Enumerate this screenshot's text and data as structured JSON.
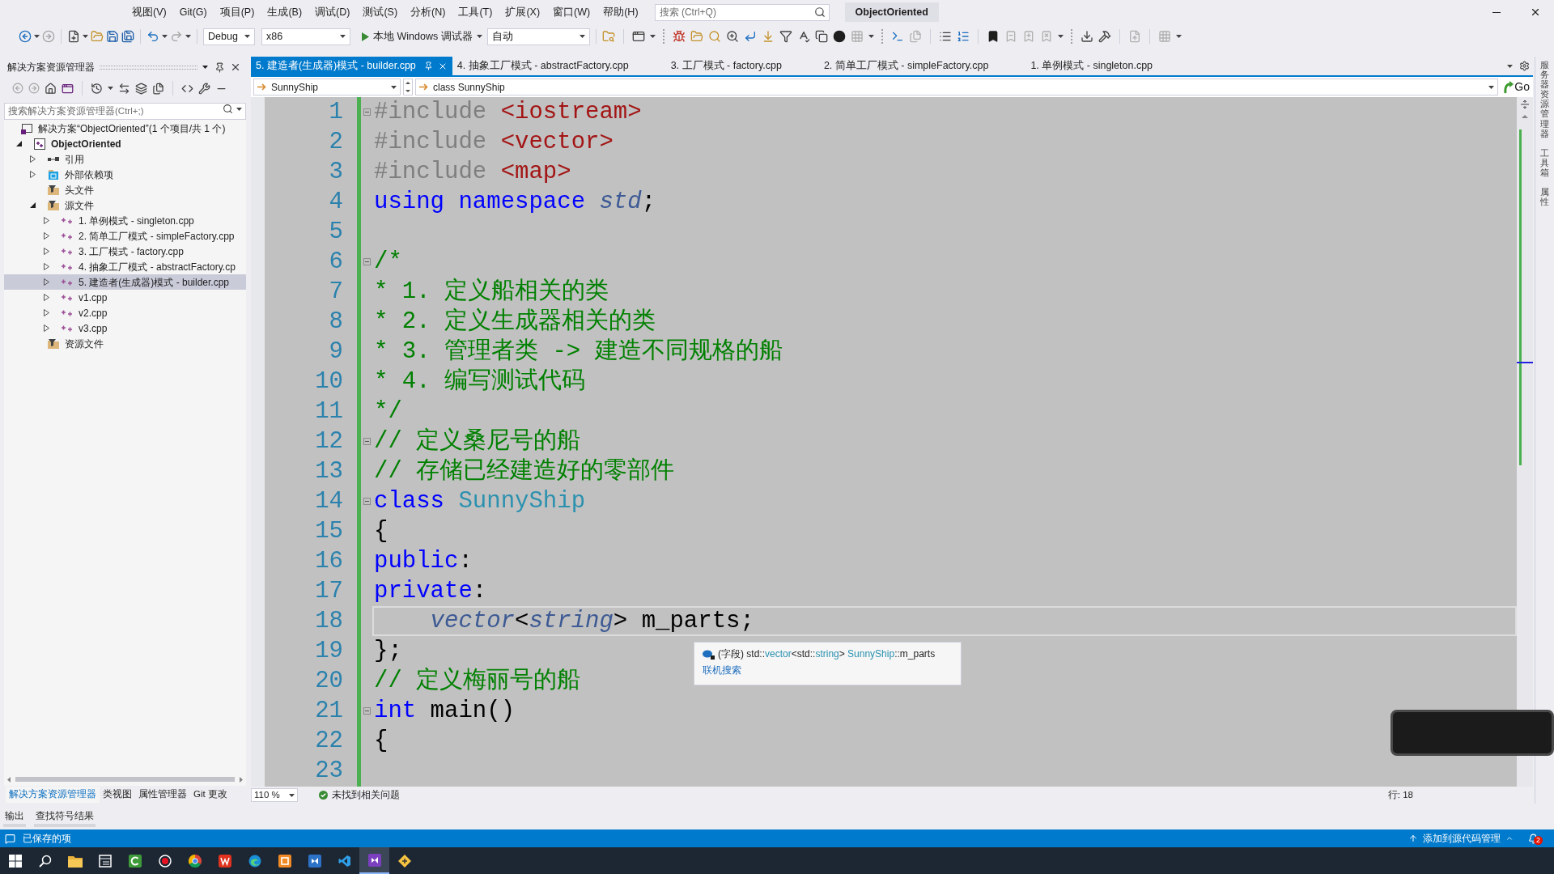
{
  "menu": [
    "视图(V)",
    "Git(G)",
    "项目(P)",
    "生成(B)",
    "调试(D)",
    "测试(S)",
    "分析(N)",
    "工具(T)",
    "扩展(X)",
    "窗口(W)",
    "帮助(H)"
  ],
  "search": {
    "placeholder": "搜索 (Ctrl+Q)"
  },
  "solution_badge": "ObjectOriented",
  "toolbar": {
    "configuration": "Debug",
    "platform": "x86",
    "run": "本地 Windows 调试器",
    "mode": "自动"
  },
  "solution_explorer": {
    "title": "解决方案资源管理器",
    "search": {
      "placeholder": "搜索解决方案资源管理器(Ctrl+;)"
    },
    "tree": [
      {
        "kind": "solution",
        "label": "解决方案“ObjectOriented”(1 个项目/共 1 个)",
        "selected": false,
        "children": [
          {
            "kind": "project",
            "label": "ObjectOriented",
            "expanded": true,
            "selected": false,
            "children": [
              {
                "kind": "references",
                "label": "引用",
                "expanded": false,
                "selected": false
              },
              {
                "kind": "dependencies",
                "label": "外部依赖项",
                "expanded": false,
                "selected": false
              },
              {
                "kind": "filter",
                "label": "头文件",
                "selected": false
              },
              {
                "kind": "filter",
                "label": "源文件",
                "expanded": true,
                "selected": false,
                "children": [
                  {
                    "kind": "file",
                    "label": "1. 单例模式 - singleton.cpp",
                    "expanded": false,
                    "selected": false
                  },
                  {
                    "kind": "file",
                    "label": "2. 简单工厂模式 - simpleFactory.cpp",
                    "expanded": false,
                    "selected": false
                  },
                  {
                    "kind": "file",
                    "label": "3. 工厂模式 - factory.cpp",
                    "expanded": false,
                    "selected": false
                  },
                  {
                    "kind": "file",
                    "label": "4. 抽象工厂模式 - abstractFactory.cp",
                    "expanded": false,
                    "selected": false
                  },
                  {
                    "kind": "file",
                    "label": "5. 建造者(生成器)模式 - builder.cpp",
                    "expanded": false,
                    "selected": true
                  },
                  {
                    "kind": "file",
                    "label": "v1.cpp",
                    "expanded": false,
                    "selected": false
                  },
                  {
                    "kind": "file",
                    "label": "v2.cpp",
                    "expanded": false,
                    "selected": false
                  },
                  {
                    "kind": "file",
                    "label": "v3.cpp",
                    "expanded": false,
                    "selected": false
                  }
                ]
              },
              {
                "kind": "filter",
                "label": "资源文件",
                "selected": false
              }
            ]
          }
        ]
      }
    ],
    "tabs": [
      {
        "label": "解决方案资源管理器",
        "selected": true
      },
      {
        "label": "类视图",
        "selected": false
      },
      {
        "label": "属性管理器",
        "selected": false
      },
      {
        "label": "Git 更改",
        "selected": false
      }
    ]
  },
  "editor": {
    "tabs": [
      {
        "label": "5. 建造者(生成器)模式 - builder.cpp",
        "selected": true
      },
      {
        "label": "4. 抽象工厂模式 - abstractFactory.cpp",
        "selected": false
      },
      {
        "label": "3. 工厂模式 - factory.cpp",
        "selected": false
      },
      {
        "label": "2. 简单工厂模式 - simpleFactory.cpp",
        "selected": false
      },
      {
        "label": "1. 单例模式 - singleton.cpp",
        "selected": false
      }
    ],
    "scope": "SunnyShip",
    "member": "class SunnyShip",
    "go": "Go",
    "lines": [
      {
        "number": "1",
        "foldable": true,
        "current": false,
        "indented": false,
        "tokens": [
          {
            "kind": "directive",
            "text": "#include "
          },
          {
            "kind": "header",
            "text": "<iostream>"
          }
        ]
      },
      {
        "number": "2",
        "foldable": false,
        "current": false,
        "indented": false,
        "tokens": [
          {
            "kind": "directive",
            "text": "#include "
          },
          {
            "kind": "header",
            "text": "<vector>"
          }
        ]
      },
      {
        "number": "3",
        "foldable": false,
        "current": false,
        "indented": false,
        "tokens": [
          {
            "kind": "directive",
            "text": "#include "
          },
          {
            "kind": "header",
            "text": "<map>"
          }
        ]
      },
      {
        "number": "4",
        "foldable": false,
        "current": false,
        "indented": false,
        "tokens": [
          {
            "kind": "keyword",
            "text": "using namespace "
          },
          {
            "kind": "namespace",
            "text": "std"
          },
          {
            "kind": "plain",
            "text": ";"
          }
        ]
      },
      {
        "number": "5",
        "foldable": false,
        "current": false
      },
      {
        "number": "6",
        "foldable": true,
        "current": false,
        "indented": false,
        "tokens": [
          {
            "kind": "comment",
            "text": "/*"
          }
        ]
      },
      {
        "number": "7",
        "foldable": false,
        "current": false,
        "indented": false,
        "tokens": [
          {
            "kind": "comment",
            "text": "* 1. 定义船相关的类"
          }
        ]
      },
      {
        "number": "8",
        "foldable": false,
        "current": false,
        "indented": false,
        "tokens": [
          {
            "kind": "comment",
            "text": "* 2. 定义生成器相关的类"
          }
        ]
      },
      {
        "number": "9",
        "foldable": false,
        "current": false,
        "indented": false,
        "tokens": [
          {
            "kind": "comment",
            "text": "* 3. 管理者类 -> 建造不同规格的船"
          }
        ]
      },
      {
        "number": "10",
        "foldable": false,
        "current": false,
        "indented": false,
        "tokens": [
          {
            "kind": "comment",
            "text": "* 4. 编写测试代码"
          }
        ]
      },
      {
        "number": "11",
        "foldable": false,
        "current": false,
        "indented": false,
        "tokens": [
          {
            "kind": "comment",
            "text": "*/"
          }
        ]
      },
      {
        "number": "12",
        "foldable": true,
        "current": false,
        "indented": false,
        "tokens": [
          {
            "kind": "comment",
            "text": "// 定义桑尼号的船"
          }
        ]
      },
      {
        "number": "13",
        "foldable": false,
        "current": false,
        "indented": false,
        "tokens": [
          {
            "kind": "comment",
            "text": "// 存储已经建造好的零部件"
          }
        ]
      },
      {
        "number": "14",
        "foldable": true,
        "current": false,
        "indented": false,
        "tokens": [
          {
            "kind": "keyword",
            "text": "class "
          },
          {
            "kind": "type",
            "text": "SunnyShip"
          }
        ]
      },
      {
        "number": "15",
        "foldable": false,
        "current": false,
        "indented": false,
        "tokens": [
          {
            "kind": "plain",
            "text": "{"
          }
        ]
      },
      {
        "number": "16",
        "foldable": false,
        "current": false,
        "indented": false,
        "tokens": [
          {
            "kind": "keyword",
            "text": "public"
          },
          {
            "kind": "plain",
            "text": ":"
          }
        ]
      },
      {
        "number": "17",
        "foldable": false,
        "current": false,
        "indented": false,
        "tokens": [
          {
            "kind": "keyword",
            "text": "private"
          },
          {
            "kind": "plain",
            "text": ":"
          }
        ]
      },
      {
        "number": "18",
        "foldable": false,
        "current": true,
        "indented": true,
        "tokens": [
          {
            "kind": "template",
            "text": "vector"
          },
          {
            "kind": "plain",
            "text": "<"
          },
          {
            "kind": "template",
            "text": "string"
          },
          {
            "kind": "plain",
            "text": "> m_parts;"
          }
        ]
      },
      {
        "number": "19",
        "foldable": false,
        "current": false,
        "indented": false,
        "tokens": [
          {
            "kind": "plain",
            "text": "};"
          }
        ]
      },
      {
        "number": "20",
        "foldable": false,
        "current": false,
        "indented": false,
        "tokens": [
          {
            "kind": "comment",
            "text": "// 定义梅丽号的船"
          }
        ]
      },
      {
        "number": "21",
        "foldable": true,
        "current": false,
        "indented": false,
        "tokens": [
          {
            "kind": "keyword",
            "text": "int"
          },
          {
            "kind": "plain",
            "text": " main()"
          }
        ]
      },
      {
        "number": "22",
        "foldable": false,
        "current": false,
        "indented": false,
        "tokens": [
          {
            "kind": "plain",
            "text": "{"
          }
        ]
      },
      {
        "number": "23",
        "foldable": false,
        "current": false
      }
    ],
    "tooltip": {
      "parts": [
        {
          "kind": "plain",
          "text": "(字段) std::"
        },
        {
          "kind": "symbol",
          "text": "vector"
        },
        {
          "kind": "plain",
          "text": "<std::"
        },
        {
          "kind": "symbol",
          "text": "string"
        },
        {
          "kind": "plain",
          "text": "> "
        },
        {
          "kind": "symbol",
          "text": "SunnyShip"
        },
        {
          "kind": "plain",
          "text": "::m_parts"
        }
      ],
      "link": "联机搜索"
    },
    "zoom": "110 %",
    "issues": "未找到相关问题",
    "position": "行: 18"
  },
  "side_tabs": [
    "服务器资源管理器",
    "工具箱",
    "属性"
  ],
  "output_tabs": [
    "输出",
    "查找符号结果"
  ],
  "status_bar": {
    "message": "已保存的项",
    "source_control": "添加到源代码管理",
    "notifications": "2"
  },
  "taskbar": [
    {
      "selected": false
    },
    {
      "selected": false
    },
    {
      "selected": false
    },
    {
      "selected": false
    },
    {
      "selected": false
    },
    {
      "selected": false
    },
    {
      "selected": false
    },
    {
      "selected": false
    },
    {
      "selected": false
    },
    {
      "selected": false
    },
    {
      "selected": false
    },
    {
      "selected": false
    },
    {
      "selected": true
    },
    {
      "selected": false
    }
  ]
}
